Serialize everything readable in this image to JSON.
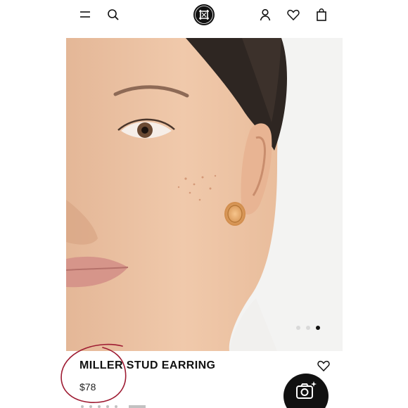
{
  "header": {
    "menu_icon": "menu-icon",
    "search_icon": "search-icon",
    "logo_icon": "brand-logo-icon",
    "account_icon": "account-icon",
    "wishlist_icon": "heart-icon",
    "bag_icon": "shopping-bag-icon"
  },
  "gallery": {
    "image_count": 3,
    "active_index": 3
  },
  "product": {
    "title": "MILLER STUD EARRING",
    "price": "$78",
    "wishlist_icon": "heart-icon"
  },
  "fab": {
    "icon": "camera-sparkle-icon"
  },
  "colors": {
    "text": "#111111",
    "annotation": "#9e1b32",
    "fab_bg": "#111111"
  }
}
